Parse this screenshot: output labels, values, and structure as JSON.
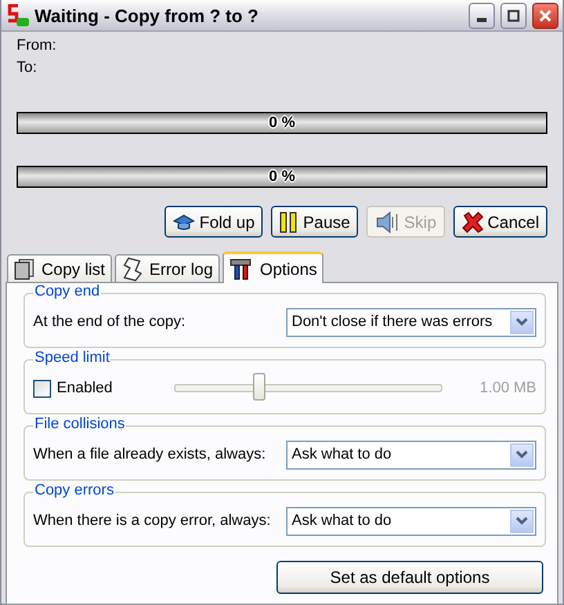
{
  "window": {
    "title": "Waiting - Copy from ? to ?"
  },
  "from_label": "From:",
  "to_label": "To:",
  "progress": [
    {
      "label": "0 %",
      "level": 0
    },
    {
      "label": "0 %",
      "level": 0
    }
  ],
  "buttons": [
    {
      "label": "Fold up",
      "kind": "fold",
      "disabled": false
    },
    {
      "label": "Pause",
      "kind": "pause",
      "disabled": false
    },
    {
      "label": "Skip",
      "kind": "skip",
      "disabled": true
    },
    {
      "label": "Cancel",
      "kind": "cancel",
      "disabled": false
    }
  ],
  "tabs": [
    {
      "label": "Copy list",
      "kind": "list",
      "selected": false
    },
    {
      "label": "Error log",
      "kind": "log",
      "selected": false
    },
    {
      "label": "Options",
      "kind": "tools",
      "selected": true
    }
  ],
  "groups": [
    {
      "title": "Copy end",
      "kind": "select",
      "label": "At the end of the copy:",
      "value": "Don't close if there was errors"
    },
    {
      "title": "Speed limit",
      "kind": "slider",
      "checkbox": {
        "label": "Enabled",
        "checked": false
      },
      "level": 0.31,
      "reading": "1.00 MB"
    },
    {
      "title": "File collisions",
      "kind": "select",
      "label": "When a file already exists, always:",
      "value": "Ask what to do"
    },
    {
      "title": "Copy errors",
      "kind": "select",
      "label": "When there is a copy error, always:",
      "value": "Ask what to do"
    }
  ],
  "default_button": "Set as default options"
}
